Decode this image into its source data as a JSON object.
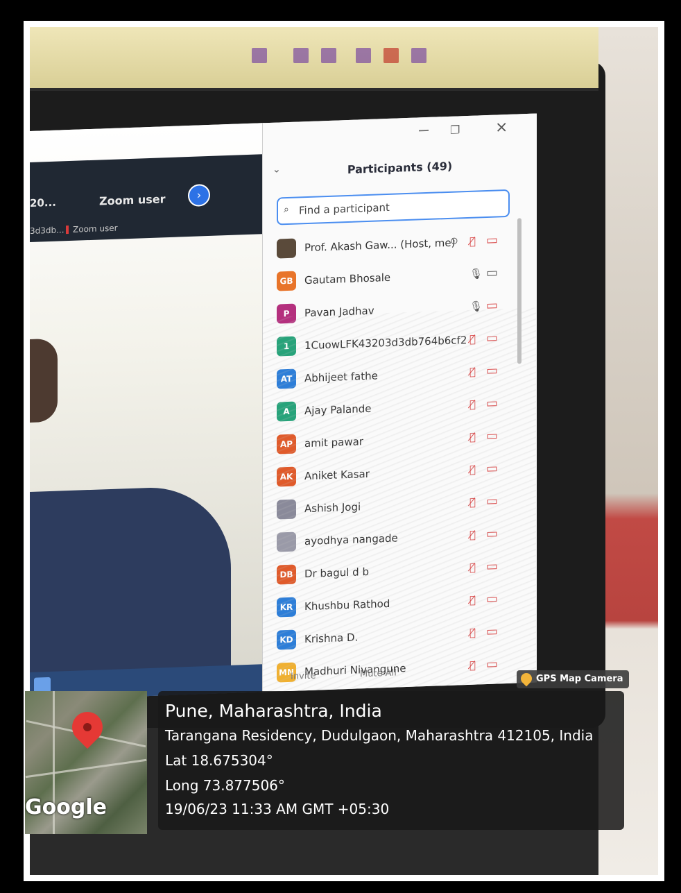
{
  "excel": {
    "ribbon_visible": true
  },
  "meeting": {
    "header_time": "20...",
    "header_name": "Zoom user",
    "sub_left": "3d3db...",
    "sub_name": "Zoom user"
  },
  "panel": {
    "title": "Participants (49)",
    "search_placeholder": "Find a participant",
    "footer_invite": "Invite",
    "footer_mute_all": "Mute All",
    "participants": [
      {
        "initials": "",
        "name": "Prof. Akash Gaw... (Host, me)",
        "color": "#5a4a3a",
        "mic": "muted",
        "cam": "off"
      },
      {
        "initials": "GB",
        "name": "Gautam Bhosale",
        "color": "#e8742a",
        "mic": "on",
        "cam": "on"
      },
      {
        "initials": "P",
        "name": "Pavan Jadhav",
        "color": "#b4307e",
        "mic": "on",
        "cam": "off"
      },
      {
        "initials": "1",
        "name": "1CuowLFK43203d3db764b6cf2",
        "color": "#27a37a",
        "mic": "muted",
        "cam": "off"
      },
      {
        "initials": "AT",
        "name": "Abhijeet fathe",
        "color": "#2d7ed8",
        "mic": "muted",
        "cam": "off"
      },
      {
        "initials": "A",
        "name": "Ajay Palande",
        "color": "#27a37a",
        "mic": "muted",
        "cam": "off"
      },
      {
        "initials": "AP",
        "name": "amit pawar",
        "color": "#e05a2a",
        "mic": "muted",
        "cam": "off"
      },
      {
        "initials": "AK",
        "name": "Aniket Kasar",
        "color": "#e05a2a",
        "mic": "muted",
        "cam": "off"
      },
      {
        "initials": "",
        "name": "Ashish Jogi",
        "color": "#8a8a9a",
        "mic": "muted",
        "cam": "off"
      },
      {
        "initials": "",
        "name": "ayodhya nangade",
        "color": "#9a9aa8",
        "mic": "muted",
        "cam": "off"
      },
      {
        "initials": "DB",
        "name": "Dr bagul d b",
        "color": "#e05a2a",
        "mic": "muted",
        "cam": "off"
      },
      {
        "initials": "KR",
        "name": "Khushbu Rathod",
        "color": "#2d7ed8",
        "mic": "muted",
        "cam": "off"
      },
      {
        "initials": "KD",
        "name": "Krishna D.",
        "color": "#2d7ed8",
        "mic": "muted",
        "cam": "off"
      },
      {
        "initials": "MN",
        "name": "Madhuri Nivangune",
        "color": "#f0b030",
        "mic": "muted",
        "cam": "off"
      }
    ]
  },
  "gps": {
    "badge": "GPS Map Camera",
    "city": "Pune, Maharashtra, India",
    "address": "Tarangana Residency, Dudulgaon, Maharashtra 412105, India",
    "lat": "Lat 18.675304°",
    "long": "Long 73.877506°",
    "datetime": "19/06/23 11:33 AM GMT +05:30",
    "map_brand": "Google"
  }
}
